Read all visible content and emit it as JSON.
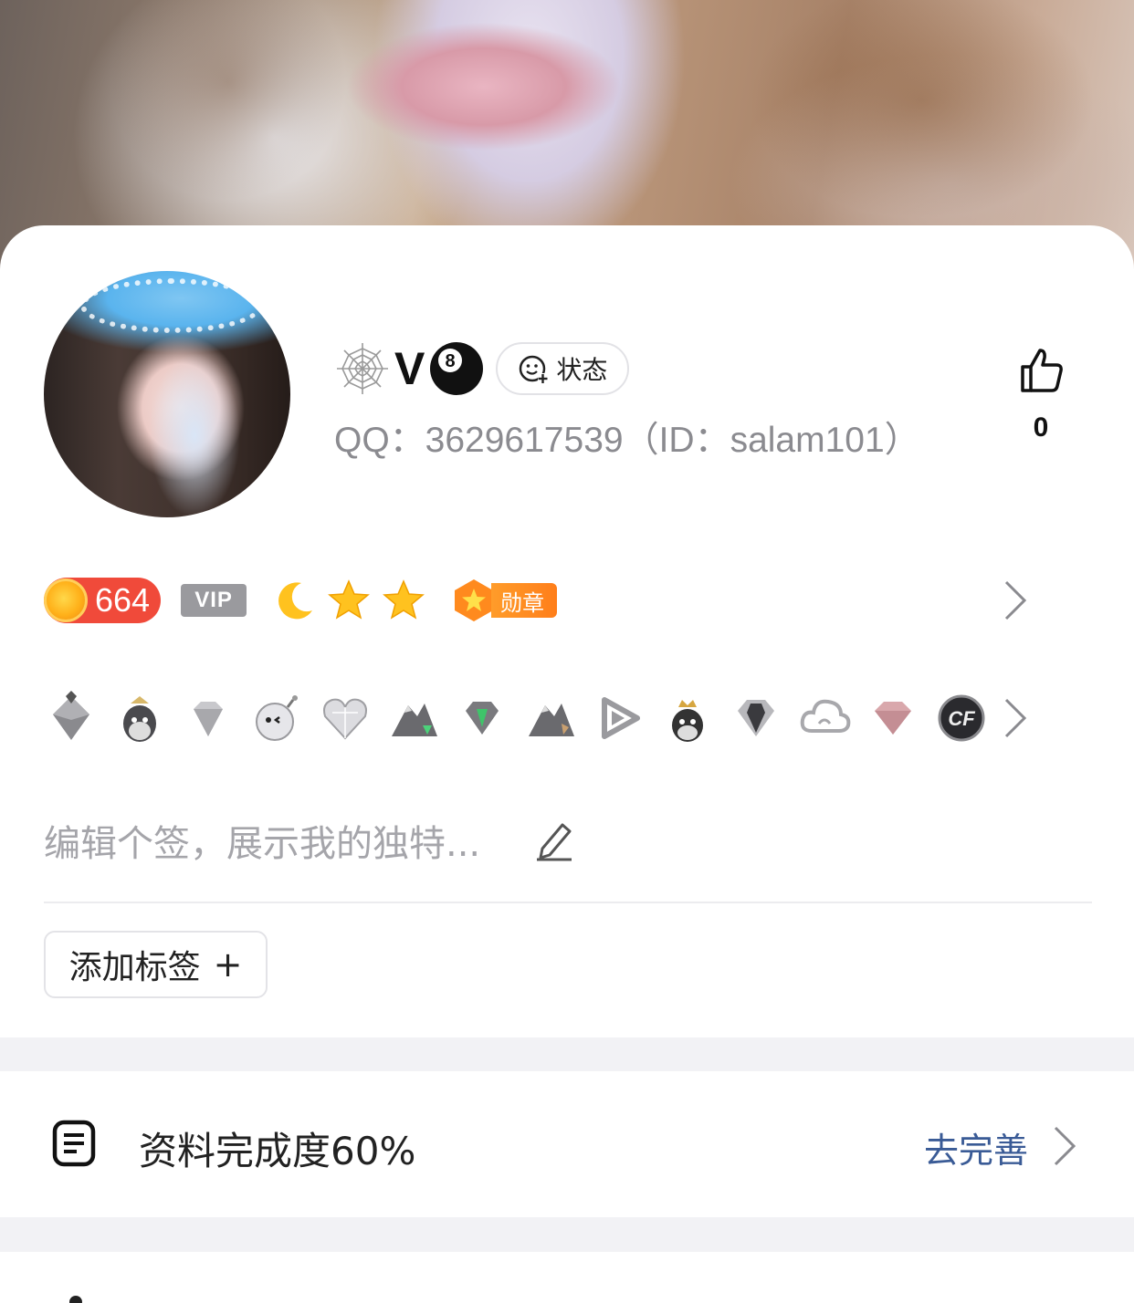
{
  "profile": {
    "name": "V",
    "status_label": "状态",
    "qq_line": "QQ：3629617539（ID：salam101）",
    "likes": "0"
  },
  "badges": {
    "level": "664",
    "vip": "VIP",
    "medal_label": "勋章"
  },
  "game_icons": [
    "diamond-pyramid-icon",
    "penguin-cap-icon",
    "silver-diamond-icon",
    "bomb-face-icon",
    "crystal-heart-icon",
    "mountain-gem-icon",
    "green-diamond-icon",
    "mountain-flag-icon",
    "video-play-icon",
    "crowned-penguin-icon",
    "dark-diamond-icon",
    "cloud-icon",
    "pink-diamond-icon",
    "cf-logo-icon"
  ],
  "signature": {
    "placeholder": "编辑个签，展示我的独特..."
  },
  "tags": {
    "add_label": "添加标签",
    "plus": "+"
  },
  "completion": {
    "label": "资料完成度60%",
    "percent": 60,
    "action": "去完善"
  },
  "colors": {
    "level_pill": "#f04a3a",
    "medal_orange": "#ff8a1e",
    "link_blue": "#3a5b96",
    "muted_text": "#8b8b90"
  }
}
